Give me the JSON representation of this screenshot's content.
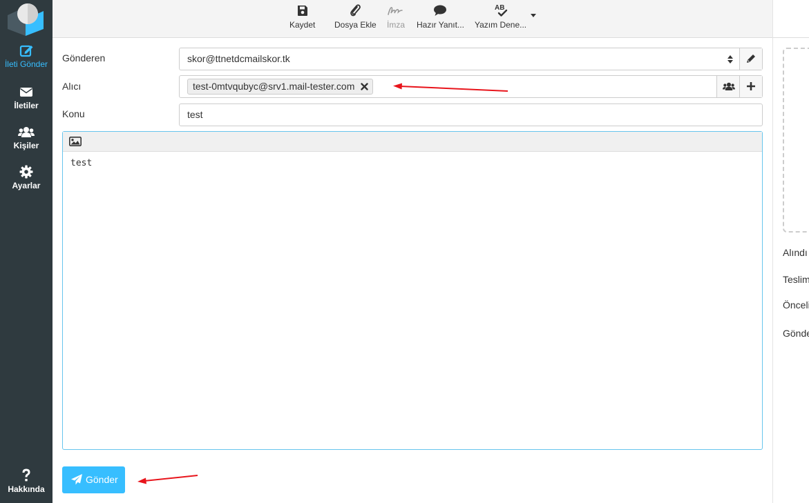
{
  "sidebar": {
    "items": [
      {
        "label": "İleti Gönder",
        "icon": "compose-icon",
        "active": true
      },
      {
        "label": "İletiler",
        "icon": "envelope-icon"
      },
      {
        "label": "Kişiler",
        "icon": "users-icon"
      },
      {
        "label": "Ayarlar",
        "icon": "gear-icon"
      }
    ],
    "about": {
      "label": "Hakkında",
      "icon": "question-icon"
    }
  },
  "toolbar": {
    "save": "Kaydet",
    "attach": "Dosya Ekle",
    "signature": "İmza",
    "responses": "Hazır Yanıt...",
    "spell": "Yazım Dene..."
  },
  "form": {
    "from_label": "Gönderen",
    "from_value": "skor@ttnetdcmailskor.tk",
    "to_label": "Alıcı",
    "to_chip": "test-0mtvqubyc@srv1.mail-tester.com",
    "subject_label": "Konu",
    "subject_value": "test"
  },
  "editor": {
    "body": "test"
  },
  "send_label": "Gönder",
  "options": {
    "receipt": "Alındı",
    "delivery": "Teslim",
    "priority": "Önceli",
    "save_sent": "Gönde"
  },
  "colors": {
    "accent": "#37beff",
    "sidebar": "#2f3a3f",
    "annotation": "#e8141b"
  }
}
